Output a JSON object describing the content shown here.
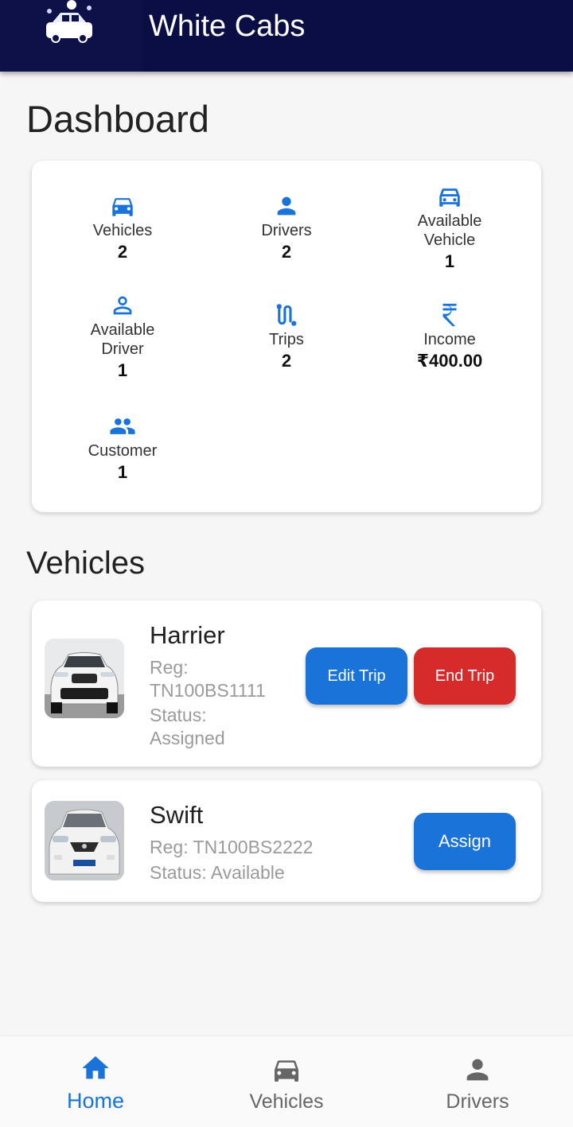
{
  "app": {
    "title": "White Cabs"
  },
  "dashboard": {
    "title": "Dashboard",
    "stats": [
      {
        "label": "Vehicles",
        "value": "2",
        "icon": "car-icon"
      },
      {
        "label": "Drivers",
        "value": "2",
        "icon": "person-icon"
      },
      {
        "label": "Available Vehicle",
        "value": "1",
        "icon": "car-outline-icon"
      },
      {
        "label": "Available Driver",
        "value": "1",
        "icon": "person-outline-icon"
      },
      {
        "label": "Trips",
        "value": "2",
        "icon": "route-icon"
      },
      {
        "label": "Income",
        "value": "₹400.00",
        "icon": "rupee-icon"
      },
      {
        "label": "Customer",
        "value": "1",
        "icon": "group-icon"
      }
    ]
  },
  "vehicles": {
    "title": "Vehicles",
    "items": [
      {
        "name": "Harrier",
        "reg_line1": "Reg:",
        "reg_line2": "TN100BS1111",
        "status_line1": "Status:",
        "status_line2": "Assigned",
        "buttons": [
          "Edit Trip",
          "End Trip"
        ]
      },
      {
        "name": "Swift",
        "reg": "Reg: TN100BS2222",
        "status": "Status: Available",
        "buttons": [
          "Assign"
        ]
      }
    ]
  },
  "nav": {
    "items": [
      {
        "label": "Home",
        "icon": "home-icon",
        "active": true
      },
      {
        "label": "Vehicles",
        "icon": "car-icon",
        "active": false
      },
      {
        "label": "Drivers",
        "icon": "person-icon",
        "active": false
      }
    ]
  },
  "colors": {
    "appbar": "#0b0e45",
    "accent": "#1a73d9",
    "danger": "#d52b2b"
  }
}
